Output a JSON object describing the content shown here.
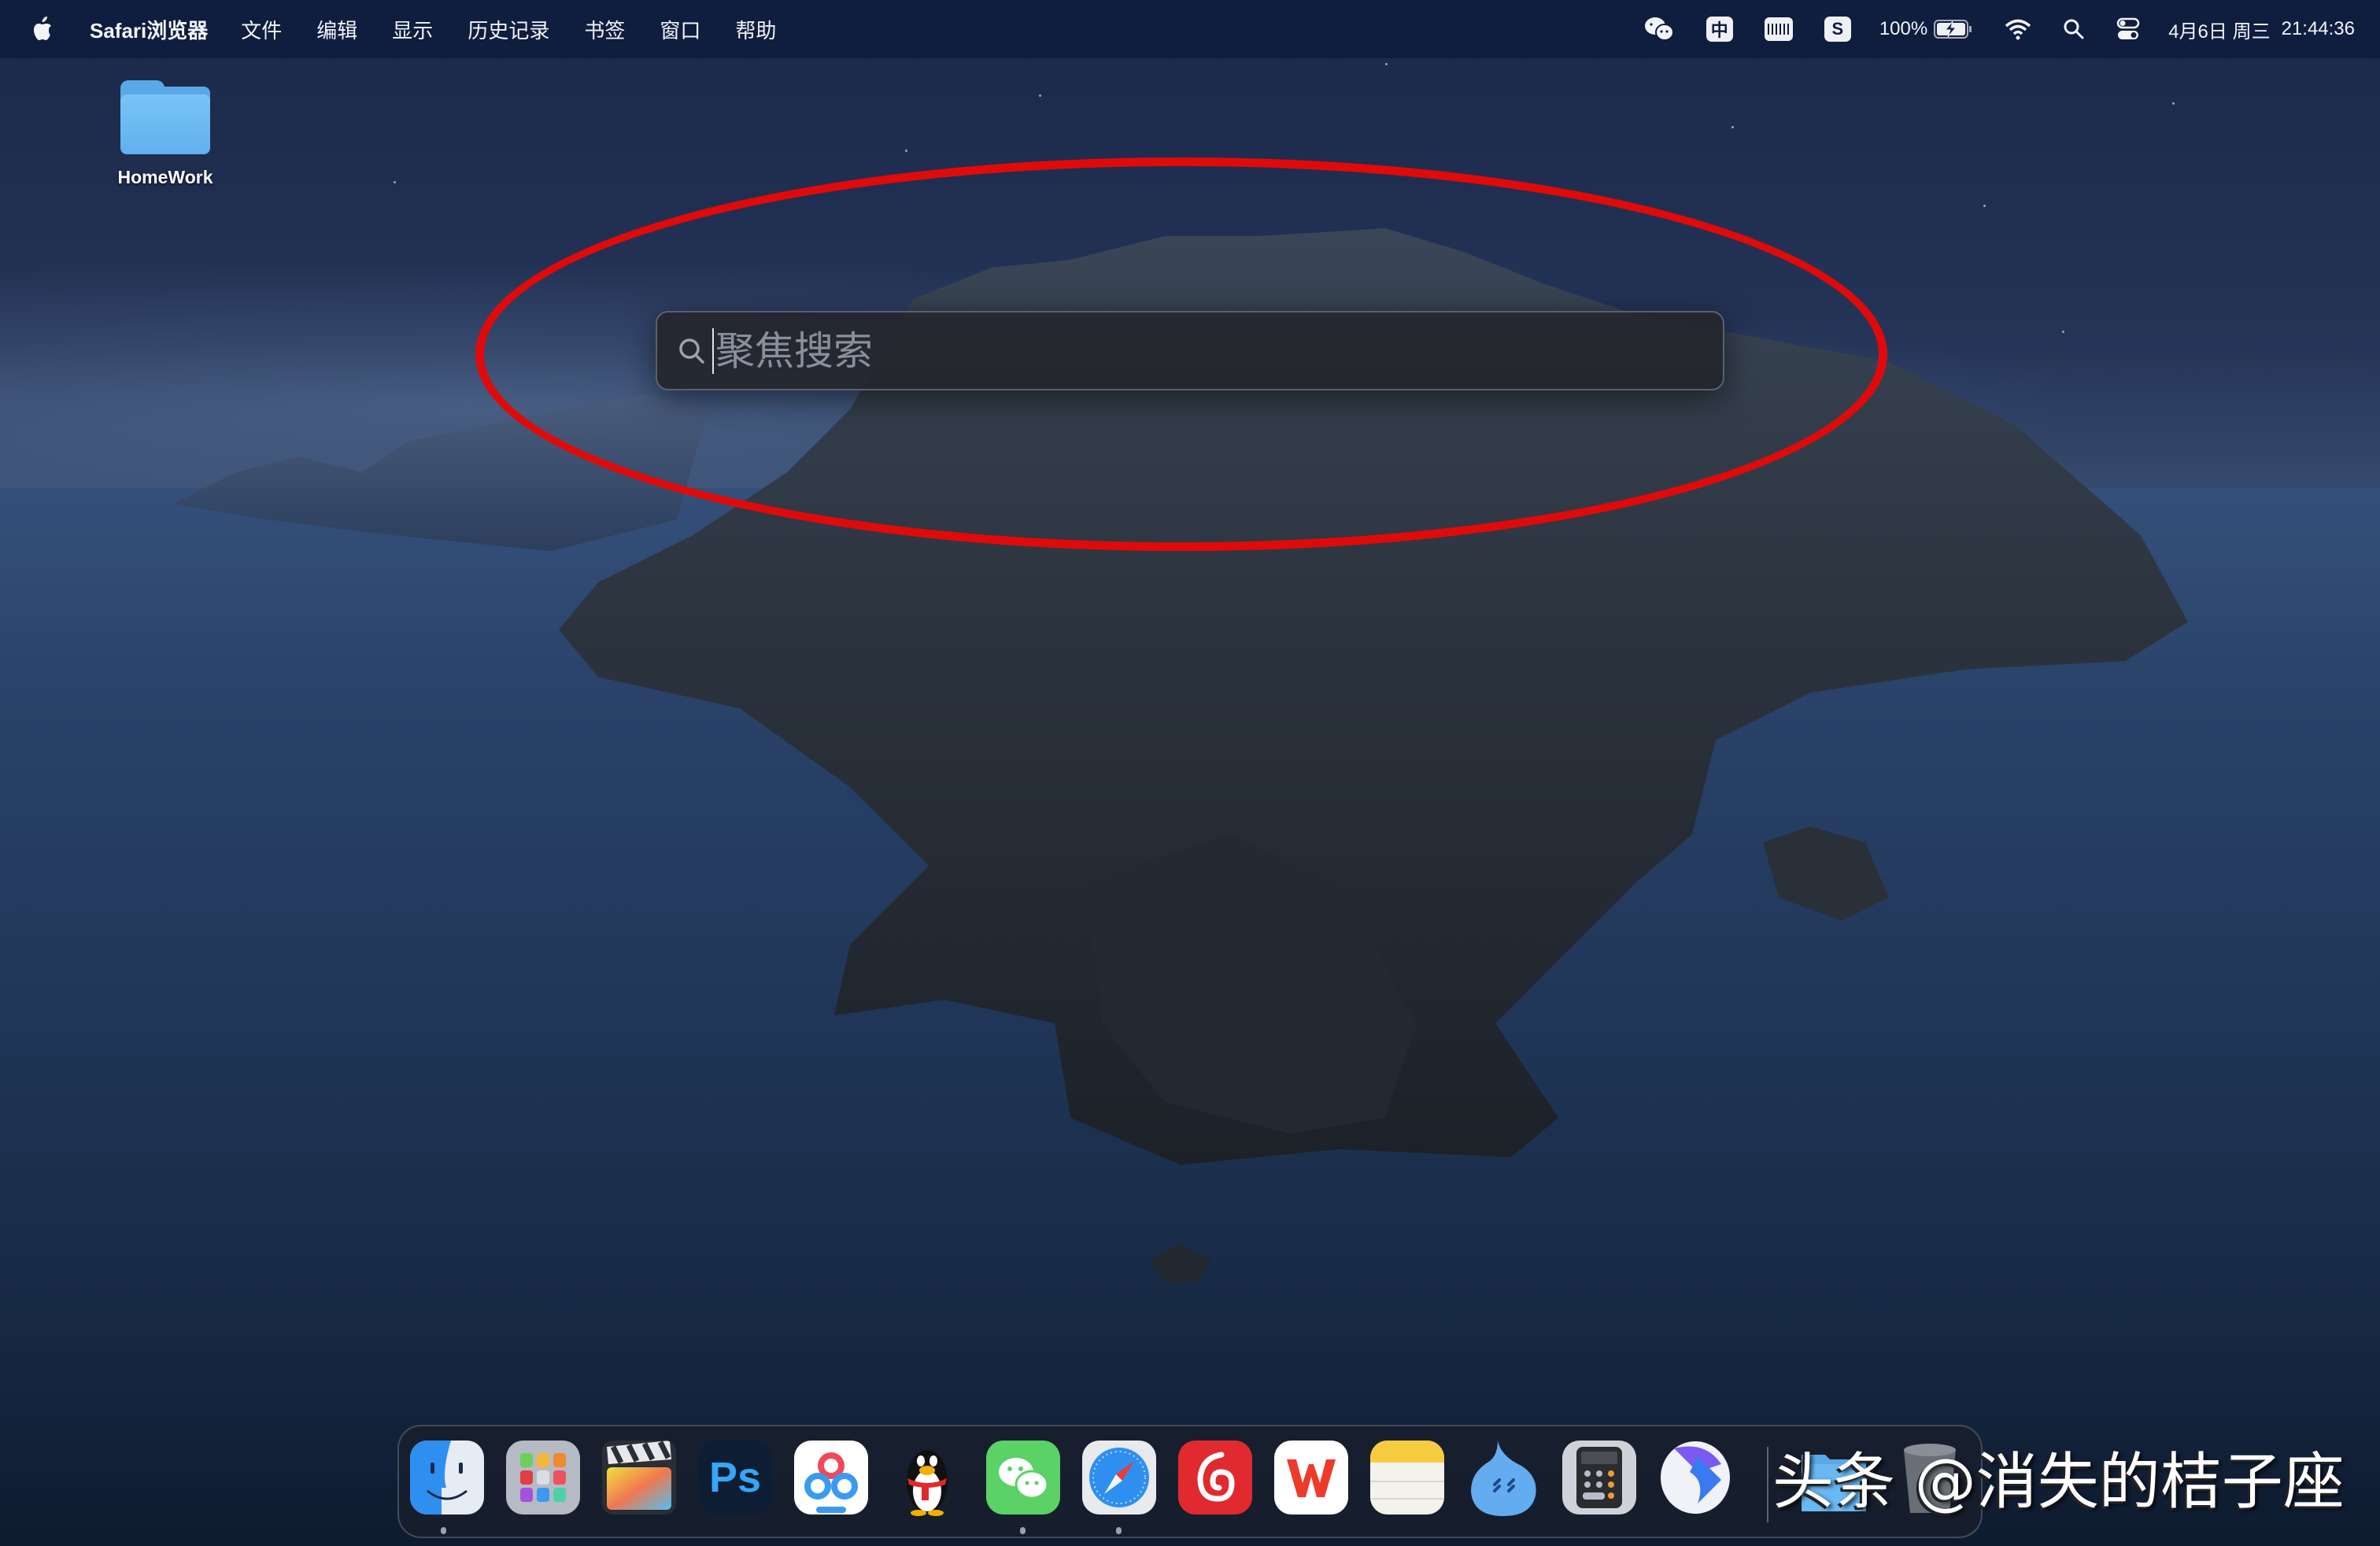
{
  "menubar": {
    "apple_icon": "apple-logo",
    "app_name": "Safari浏览器",
    "items": [
      "文件",
      "编辑",
      "显示",
      "历史记录",
      "书签",
      "窗口",
      "帮助"
    ],
    "tray": {
      "wechat_icon": "wechat-icon",
      "input_method": "中",
      "keyboard_icon": "barcode-keyboard-icon",
      "s_app": "S",
      "battery_percent": "100%",
      "battery_icon": "battery-charging-icon",
      "wifi_icon": "wifi-icon",
      "search_icon": "spotlight-search-icon",
      "control_center_icon": "control-center-icon",
      "date": "4月6日 周三",
      "time": "21:44:36"
    }
  },
  "desktop": {
    "items": [
      {
        "label": "HomeWork",
        "icon": "folder-icon"
      }
    ]
  },
  "spotlight": {
    "placeholder": "聚焦搜索",
    "value": "",
    "icon": "search-icon"
  },
  "annotation": {
    "color": "#e00a0a",
    "shape": "ellipse"
  },
  "dock": {
    "apps": [
      {
        "name": "Finder",
        "running": true
      },
      {
        "name": "Launchpad",
        "running": false
      },
      {
        "name": "Final Cut Pro",
        "running": false
      },
      {
        "name": "Photoshop",
        "label": "Ps",
        "running": false
      },
      {
        "name": "Baidu Netdisk",
        "running": false
      },
      {
        "name": "QQ",
        "running": false
      },
      {
        "name": "WeChat",
        "running": true
      },
      {
        "name": "Safari",
        "running": true
      },
      {
        "name": "NetEase Cloud Music",
        "running": false
      },
      {
        "name": "WPS Office",
        "running": false
      },
      {
        "name": "Notes",
        "running": false
      },
      {
        "name": "QQ Browser",
        "running": false
      },
      {
        "name": "Calculator",
        "running": false
      },
      {
        "name": "Feishu",
        "running": false
      }
    ],
    "after_separator": [
      {
        "name": "Downloads"
      },
      {
        "name": "Trash"
      }
    ]
  },
  "watermark": "头条 @消失的桔子座",
  "colors": {
    "menubar": "#0e1c3e",
    "annotation_red": "#e00a0a",
    "spotlight_bg": "#24262e"
  }
}
